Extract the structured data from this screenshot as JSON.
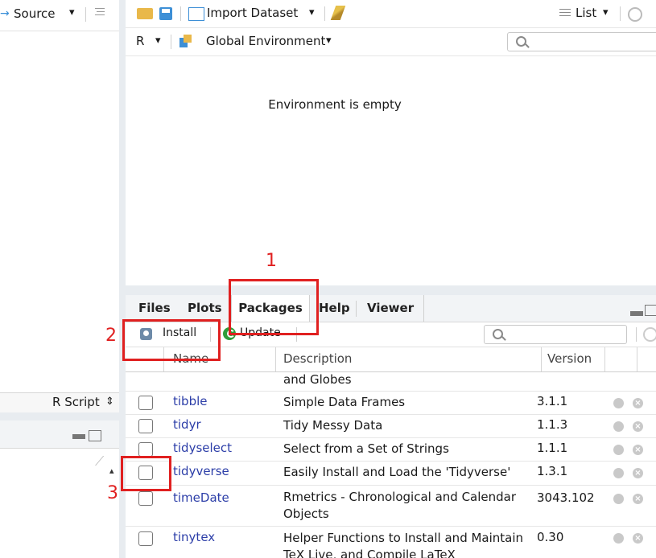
{
  "left_pane": {
    "source_label": "Source",
    "source_arrow": "→",
    "dropdown": "▾",
    "script_type": "R Script",
    "script_type_arrow": "⇕",
    "scroll_up": "▴"
  },
  "env_toolbar": {
    "import_dataset": "Import Dataset",
    "list_label": "List",
    "dropdown": "▾"
  },
  "env_subbar": {
    "language": "R",
    "environment": "Global Environment",
    "dropdown": "▾"
  },
  "env_empty_message": "Environment is empty",
  "tabs": [
    "Files",
    "Plots",
    "Packages",
    "Help",
    "Viewer"
  ],
  "pkg_toolbar": {
    "install": "Install",
    "update": "Update"
  },
  "table": {
    "col_name": "Name",
    "col_description": "Description",
    "col_version": "Version",
    "partial_prev_row": "and Globes",
    "rows": [
      {
        "name": "tibble",
        "description": "Simple Data Frames",
        "version": "3.1.1"
      },
      {
        "name": "tidyr",
        "description": "Tidy Messy Data",
        "version": "1.1.3"
      },
      {
        "name": "tidyselect",
        "description": "Select from a Set of Strings",
        "version": "1.1.1"
      },
      {
        "name": "tidyverse",
        "description": "Easily Install and Load the 'Tidyverse'",
        "version": "1.3.1"
      },
      {
        "name": "timeDate",
        "description": "Rmetrics - Chronological and Calendar Objects",
        "version": "3043.102"
      },
      {
        "name": "tinytex",
        "description": "Helper Functions to Install and Maintain TeX Live, and Compile LaTeX",
        "version": "0.30"
      }
    ]
  },
  "annotations": [
    "1",
    "2",
    "3"
  ],
  "colors": {
    "annotation_red": "#e02020",
    "package_link": "#2c3ea8",
    "splitter": "#e8ecf0"
  },
  "icons": [
    "arrow-right-icon",
    "align-icon",
    "open-folder-icon",
    "save-icon",
    "import-icon",
    "broom-icon",
    "list-icon",
    "refresh-icon",
    "environment-icon",
    "search-icon",
    "install-icon",
    "update-icon",
    "globe-icon",
    "delete-icon",
    "minimize-icon",
    "maximize-icon"
  ]
}
